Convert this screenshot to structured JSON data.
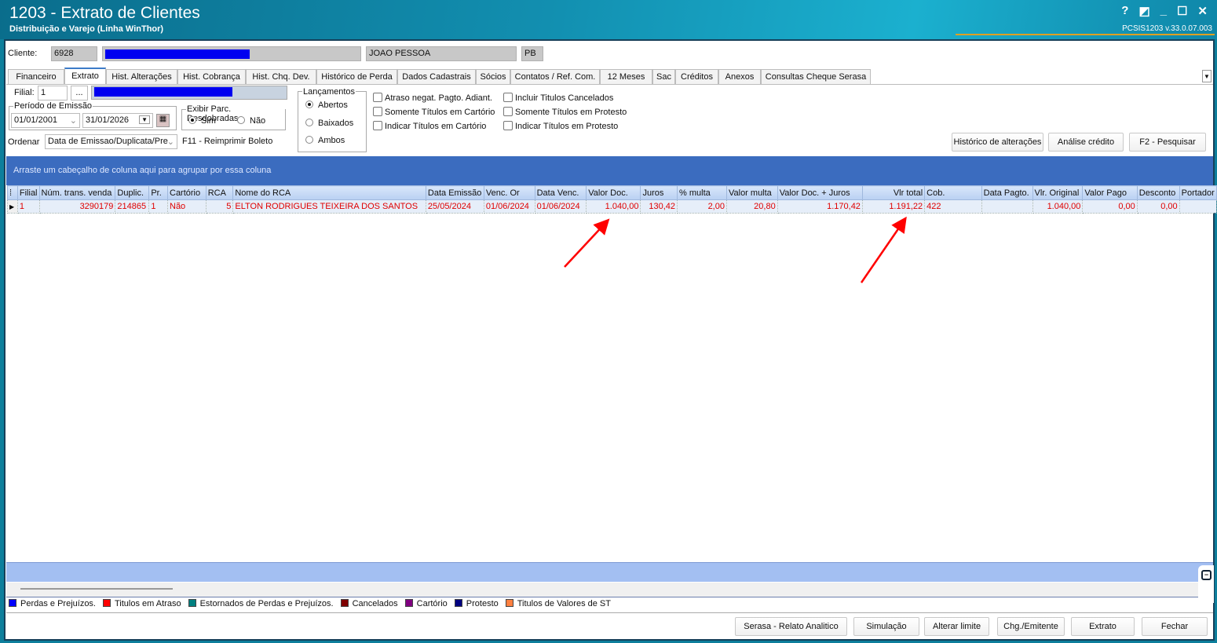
{
  "window": {
    "title": "1203 - Extrato de Clientes",
    "subtitle": "Distribuição e Varejo (Linha WinThor)",
    "version": "PCSIS1203  v.33.0.07.003",
    "controls": [
      "?",
      "◩",
      "_",
      "☐",
      "✕"
    ]
  },
  "client": {
    "label": "Cliente:",
    "code": "6928",
    "city": "JOAO PESSOA",
    "state": "PB"
  },
  "tabs": [
    "Financeiro",
    "Extrato",
    "Hist. Alterações",
    "Hist. Cobrança",
    "Hist. Chq. Dev.",
    "Histórico de Perda",
    "Dados Cadastrais",
    "Sócios",
    "Contatos / Ref. Com.",
    "12 Meses",
    "Sac",
    "Créditos",
    "Anexos",
    "Consultas Cheque Serasa"
  ],
  "active_tab": "Extrato",
  "filters": {
    "filial_label": "Filial:",
    "filial_value": "1",
    "filial_btn": "...",
    "periodo_label": "Período de Emissão",
    "date_from": "01/01/2001",
    "date_to": "31/01/2026",
    "exibir_label": "Exibir Parc. Desdobradas",
    "sim": "Sim",
    "nao": "Não",
    "ordenar_label": "Ordenar",
    "ordenar_value": "Data de Emissao/Duplicata/Pre",
    "f11": "F11 - Reimprimir Boleto",
    "lanc_label": "Lançamentos",
    "lanc_options": [
      "Abertos",
      "Baixados",
      "Ambos"
    ],
    "checks_col1": [
      "Atraso negat. Pagto. Adiant.",
      "Somente Títulos em Cartório",
      "Indicar Títulos em Cartório"
    ],
    "checks_col2": [
      "Incluir Titulos Cancelados",
      "Somente Títulos em Protesto",
      "Indicar Títulos em Protesto"
    ]
  },
  "actions": {
    "historico": "Histórico de alterações",
    "analise": "Análise crédito",
    "pesquisar": "F2 - Pesquisar"
  },
  "grid": {
    "group_hint": "Arraste um cabeçalho de coluna aqui para agrupar por essa coluna",
    "columns": [
      "Filial",
      "Núm. trans. venda",
      "Duplic.",
      "Pr.",
      "Cartório",
      "RCA",
      "Nome do RCA",
      "Data Emissão",
      "Venc. Or",
      "Data Venc.",
      "Valor Doc.",
      "Juros",
      "% multa",
      "Valor multa",
      "Valor Doc. + Juros",
      "Vlr total",
      "Cob.",
      "Data Pagto.",
      "Vlr. Original",
      "Valor Pago",
      "Desconto",
      "Portador"
    ],
    "rows": [
      [
        "1",
        "3290179",
        "214865",
        "1",
        "Não",
        "5",
        "ELTON RODRIGUES TEIXEIRA DOS SANTOS",
        "25/05/2024",
        "01/06/2024",
        "01/06/2024",
        "1.040,00",
        "130,42",
        "2,00",
        "20,80",
        "1.170,42",
        "1.191,22",
        "422",
        "",
        "1.040,00",
        "0,00",
        "0,00",
        ""
      ]
    ]
  },
  "legend": [
    {
      "label": "Perdas e Prejuízos.",
      "color": "#0000ff"
    },
    {
      "label": "Titulos em Atraso",
      "color": "#ff0000"
    },
    {
      "label": "Estornados de Perdas e Prejuízos.",
      "color": "#008080"
    },
    {
      "label": "Cancelados",
      "color": "#800000"
    },
    {
      "label": "Cartório",
      "color": "#800080"
    },
    {
      "label": "Protesto",
      "color": "#000080"
    },
    {
      "label": "Titulos de Valores de ST",
      "color": "#ff8040"
    }
  ],
  "footer_buttons": [
    "Serasa - Relato Analitico",
    "Simulação",
    "Alterar limite",
    "Chg./Emitente",
    "Extrato",
    "Fechar"
  ]
}
